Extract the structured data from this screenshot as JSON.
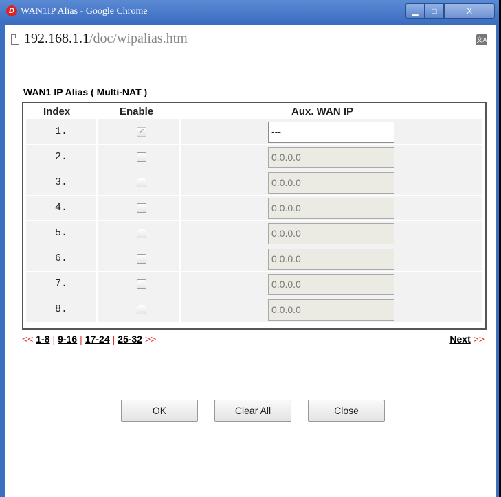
{
  "window": {
    "title": "WAN1IP Alias - Google Chrome"
  },
  "address": {
    "host": "192.168.1.1",
    "path": "/doc/wipalias.htm"
  },
  "icons": {
    "favicon": "draytek-logo-icon",
    "page": "page-icon",
    "translate": "translate-icon"
  },
  "section": {
    "title": "WAN1 IP Alias ( Multi-NAT )"
  },
  "table": {
    "headers": {
      "index": "Index",
      "enable": "Enable",
      "aux_wan_ip": "Aux. WAN IP"
    },
    "rows": [
      {
        "index": "1.",
        "enabled": true,
        "checkbox_disabled": true,
        "ip": "---"
      },
      {
        "index": "2.",
        "enabled": false,
        "checkbox_disabled": false,
        "ip": "0.0.0.0"
      },
      {
        "index": "3.",
        "enabled": false,
        "checkbox_disabled": false,
        "ip": "0.0.0.0"
      },
      {
        "index": "4.",
        "enabled": false,
        "checkbox_disabled": false,
        "ip": "0.0.0.0"
      },
      {
        "index": "5.",
        "enabled": false,
        "checkbox_disabled": false,
        "ip": "0.0.0.0"
      },
      {
        "index": "6.",
        "enabled": false,
        "checkbox_disabled": false,
        "ip": "0.0.0.0"
      },
      {
        "index": "7.",
        "enabled": false,
        "checkbox_disabled": false,
        "ip": "0.0.0.0"
      },
      {
        "index": "8.",
        "enabled": false,
        "checkbox_disabled": false,
        "ip": "0.0.0.0"
      }
    ]
  },
  "pager": {
    "prev_arrow": "<<",
    "ranges": [
      "1-8",
      "9-16",
      "17-24",
      "25-32"
    ],
    "next_arrow": ">>",
    "separator": "|",
    "next_label": "Next",
    "next_arrow_right": ">>"
  },
  "buttons": {
    "ok": "OK",
    "clear_all": "Clear All",
    "close": "Close"
  },
  "colors": {
    "accent_red": "#e03030",
    "titlebar": "#3a6cc0"
  }
}
